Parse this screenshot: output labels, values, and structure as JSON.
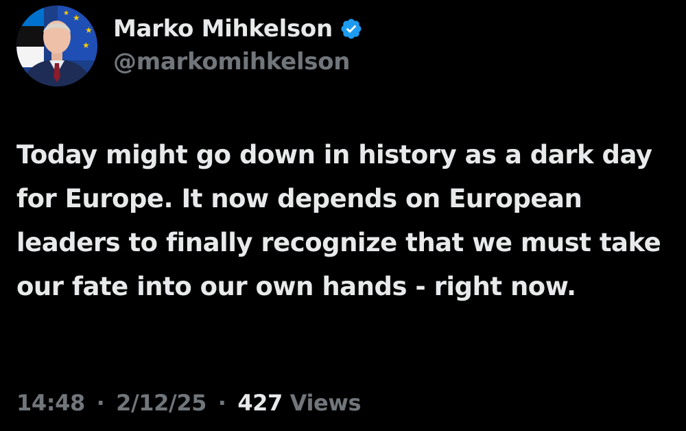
{
  "author": {
    "display_name": "Marko Mihkelson",
    "handle": "@markomihkelson",
    "avatar_icon": "profile-photo",
    "verified_icon": "verified-badge-icon",
    "verified_color": "#1d9bf0"
  },
  "tweet": {
    "text": "Today might go down in history as a dark day for Europe. It now depends on European leaders to finally recognize that we must take our fate into our own hands - right now."
  },
  "meta": {
    "time": "14:48",
    "separator": "·",
    "date": "2/12/25",
    "views_count": "427",
    "views_label": "Views"
  },
  "colors": {
    "background": "#000000",
    "primary_text": "#e7e9ea",
    "secondary_text": "#71767b"
  }
}
